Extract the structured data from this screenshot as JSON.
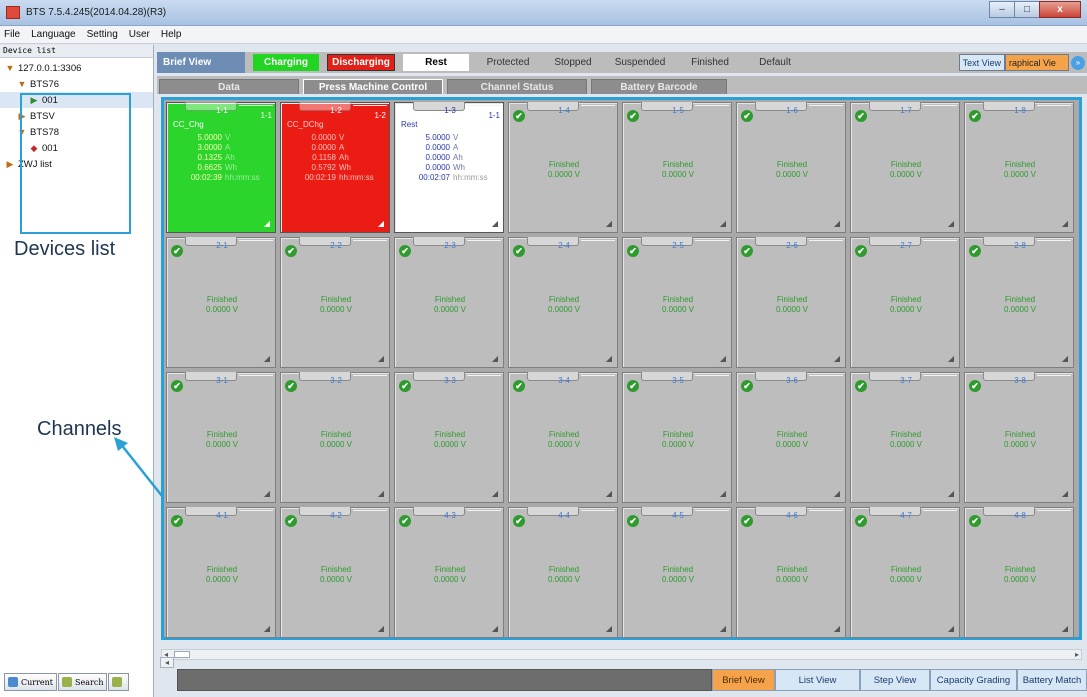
{
  "window": {
    "title": "BTS 7.5.4.245(2014.04.28)(R3)",
    "controls": {
      "minimize": "–",
      "maximize": "□",
      "close": "x"
    }
  },
  "menu": [
    "File",
    "Language",
    "Setting",
    "User",
    "Help"
  ],
  "sidebar": {
    "header": "Device list",
    "tree": [
      {
        "label": "127.0.0.1:3306",
        "glyph": "▼",
        "indent": 0,
        "icon": "expand-arrow-icon"
      },
      {
        "label": "BTS76",
        "glyph": "▼",
        "indent": 1,
        "icon": "expand-arrow-icon"
      },
      {
        "label": "001",
        "glyph": "▶",
        "indent": 2,
        "icon": "device-running-icon",
        "selected": true
      },
      {
        "label": "BTSV",
        "glyph": "▶",
        "indent": 1,
        "icon": "collapsed-arrow-icon"
      },
      {
        "label": "BTS78",
        "glyph": "▼",
        "indent": 1,
        "icon": "expand-arrow-icon"
      },
      {
        "label": "001",
        "glyph": "◆",
        "indent": 2,
        "icon": "device-error-icon"
      },
      {
        "label": "ZWJ list",
        "glyph": "▶",
        "indent": 0,
        "icon": "collapsed-arrow-icon"
      }
    ],
    "bottom_tabs": [
      "Current",
      "Search",
      ""
    ]
  },
  "annotations": {
    "devices_list": "Devices list",
    "channels": "Channels"
  },
  "legend": {
    "brief_view": "Brief View",
    "items": [
      "Charging",
      "Discharging",
      "Rest",
      "Protected",
      "Stopped",
      "Suspended",
      "Finished",
      "Default"
    ],
    "text_view": "Text View",
    "graphical_view": "raphical Vie",
    "more": "»"
  },
  "tabs": [
    "Data",
    "Press Machine Control",
    "Channel Status",
    "Battery Barcode"
  ],
  "active_channels": [
    {
      "id": "1-1",
      "corner": "1-1",
      "state": "charging",
      "mode": "CC_Chg",
      "rows": [
        {
          "value": "5.0000",
          "unit": "V"
        },
        {
          "value": "3.0000",
          "unit": "A"
        },
        {
          "value": "0.1325",
          "unit": "Ah"
        },
        {
          "value": "0.6625",
          "unit": "Wh"
        },
        {
          "value": "00:02:39",
          "unit": "hh:mm:ss"
        }
      ]
    },
    {
      "id": "1-2",
      "corner": "1-2",
      "state": "discharging",
      "mode": "CC_DChg",
      "rows": [
        {
          "value": "0.0000",
          "unit": "V"
        },
        {
          "value": "0.0000",
          "unit": "A"
        },
        {
          "value": "0.1158",
          "unit": "Ah"
        },
        {
          "value": "0.5792",
          "unit": "Wh"
        },
        {
          "value": "00:02:19",
          "unit": "hh:mm:ss"
        }
      ]
    },
    {
      "id": "1-3",
      "corner": "1-1",
      "state": "rest",
      "mode": "Rest",
      "rows": [
        {
          "value": "5.0000",
          "unit": "V"
        },
        {
          "value": "0.0000",
          "unit": "A"
        },
        {
          "value": "0.0000",
          "unit": "Ah"
        },
        {
          "value": "0.0000",
          "unit": "Wh"
        },
        {
          "value": "00:02:07",
          "unit": "hh:mm:ss"
        }
      ]
    }
  ],
  "finished_channel": {
    "status": "Finished",
    "voltage": "0.0000 V",
    "check": "✔",
    "corner": "◢"
  },
  "channel_ids": [
    [
      "1-1",
      "1-2",
      "1-3",
      "1-4",
      "1-5",
      "1-6",
      "1-7",
      "1-8"
    ],
    [
      "2-1",
      "2-2",
      "2-3",
      "2-4",
      "2-5",
      "2-6",
      "2-7",
      "2-8"
    ],
    [
      "3-1",
      "3-2",
      "3-3",
      "3-4",
      "3-5",
      "3-6",
      "3-7",
      "3-8"
    ],
    [
      "4-1",
      "4-2",
      "4-3",
      "4-4",
      "4-5",
      "4-6",
      "4-7",
      "4-8"
    ]
  ],
  "bottom_views": [
    "Brief View",
    "List View",
    "Step View",
    "Capacity Grading",
    "Battery Match"
  ],
  "bottom_active": "Brief View",
  "colors": {
    "charging": "#2cd52c",
    "discharging": "#ea1c14",
    "rest": "#ffffff",
    "finished": "#bdbdbd",
    "highlight": "#2aa0d6",
    "accent_active": "#f5a34a"
  }
}
